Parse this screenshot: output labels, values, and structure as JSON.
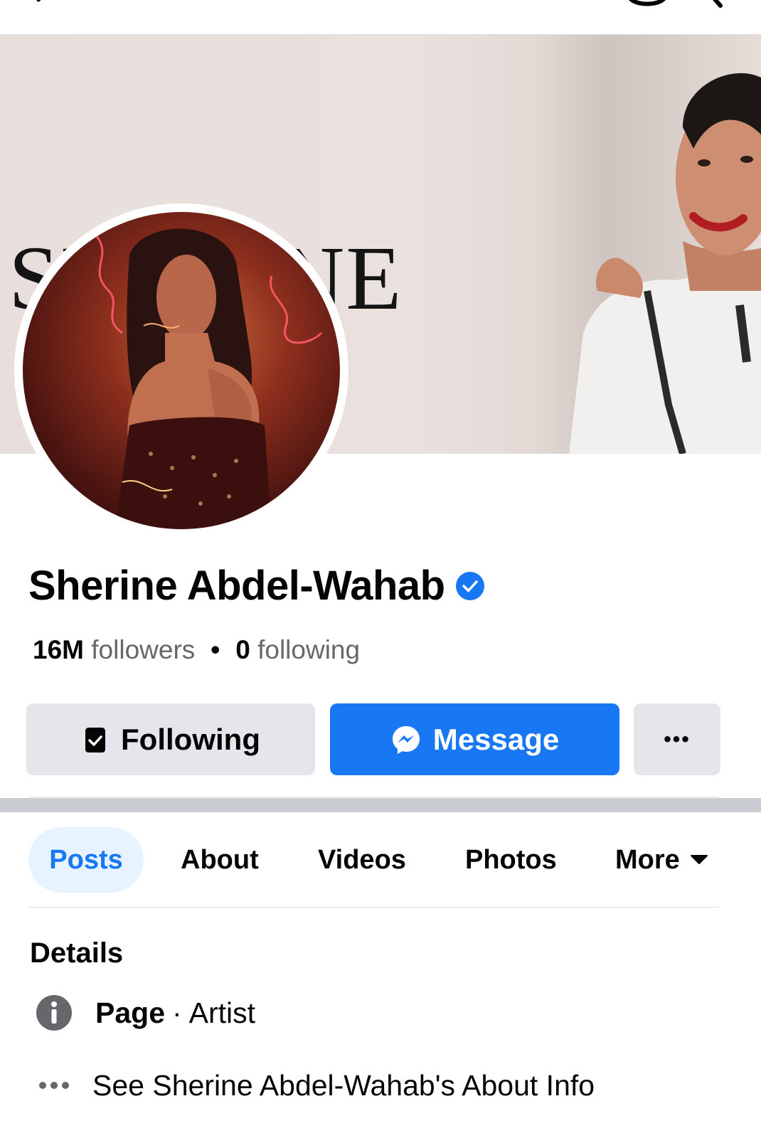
{
  "profile": {
    "name": "Sherine Abdel-Wahab",
    "cover_text": "SHERINE",
    "followers_count": "16M",
    "followers_label": "followers",
    "following_count": "0",
    "following_label": "following"
  },
  "actions": {
    "following_label": "Following",
    "message_label": "Message",
    "more_label": "•••"
  },
  "tabs": [
    {
      "label": "Posts",
      "active": true
    },
    {
      "label": "About",
      "active": false
    },
    {
      "label": "Videos",
      "active": false
    },
    {
      "label": "Photos",
      "active": false
    },
    {
      "label": "More",
      "active": false
    }
  ],
  "details": {
    "heading": "Details",
    "category_bold": "Page",
    "category_sep": "·",
    "category_value": "Artist",
    "about_link": "See Sherine Abdel-Wahab's About Info"
  },
  "colors": {
    "accent": "#1877f2",
    "button_gray": "#e4e6eb",
    "tab_active_bg": "#e7f3ff"
  },
  "icons": [
    "back-arrow-icon",
    "messenger-icon",
    "search-icon",
    "verified-badge-icon",
    "following-check-icon",
    "messenger-icon",
    "more-dots-icon",
    "chevron-down-icon",
    "info-icon",
    "more-dots-icon"
  ]
}
